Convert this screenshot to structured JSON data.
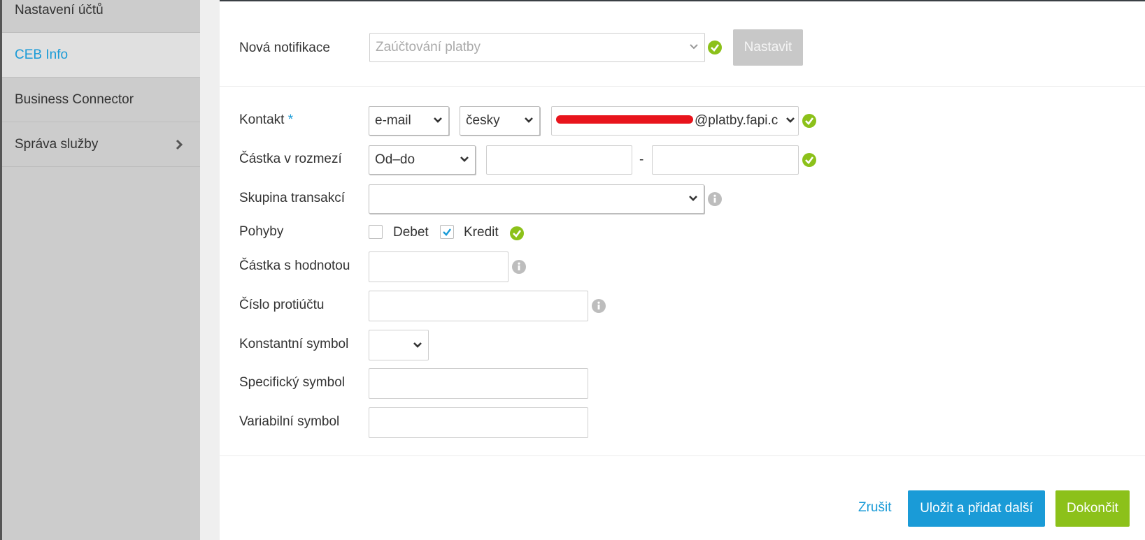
{
  "sidebar": {
    "items": [
      {
        "label": "Nastavení účtů"
      },
      {
        "label": "CEB Info",
        "active": true
      },
      {
        "label": "Business Connector"
      },
      {
        "label": "Správa služby"
      }
    ]
  },
  "notification": {
    "label": "Nová notifikace",
    "select_placeholder": "Zaúčtování platby",
    "set_button": "Nastavit"
  },
  "form": {
    "contact": {
      "label": "Kontakt",
      "required_mark": "*",
      "type_value": "e-mail",
      "language_value": "česky",
      "address_visible_part": "@platby.fapi.c"
    },
    "amount_range": {
      "label": "Částka v rozmezí",
      "mode_value": "Od–do",
      "from_value": "",
      "separator": "-",
      "to_value": ""
    },
    "transaction_group": {
      "label": "Skupina transakcí",
      "value": ""
    },
    "movements": {
      "label": "Pohyby",
      "debit_label": "Debet",
      "debit_checked": false,
      "credit_label": "Kredit",
      "credit_checked": true
    },
    "amount_value": {
      "label": "Částka s hodnotou",
      "value": ""
    },
    "counter_account": {
      "label": "Číslo protiúčtu",
      "value": ""
    },
    "constant_symbol": {
      "label": "Konstantní symbol",
      "value": ""
    },
    "specific_symbol": {
      "label": "Specifický symbol",
      "value": ""
    },
    "variable_symbol": {
      "label": "Variabilní symbol",
      "value": ""
    }
  },
  "actions": {
    "cancel": "Zrušit",
    "save_add": "Uložit a přidat další",
    "finish": "Dokončit"
  },
  "colors": {
    "accent_blue": "#1a9bd7",
    "success_green": "#8cc11a",
    "sidebar_bg": "#cccccc"
  }
}
